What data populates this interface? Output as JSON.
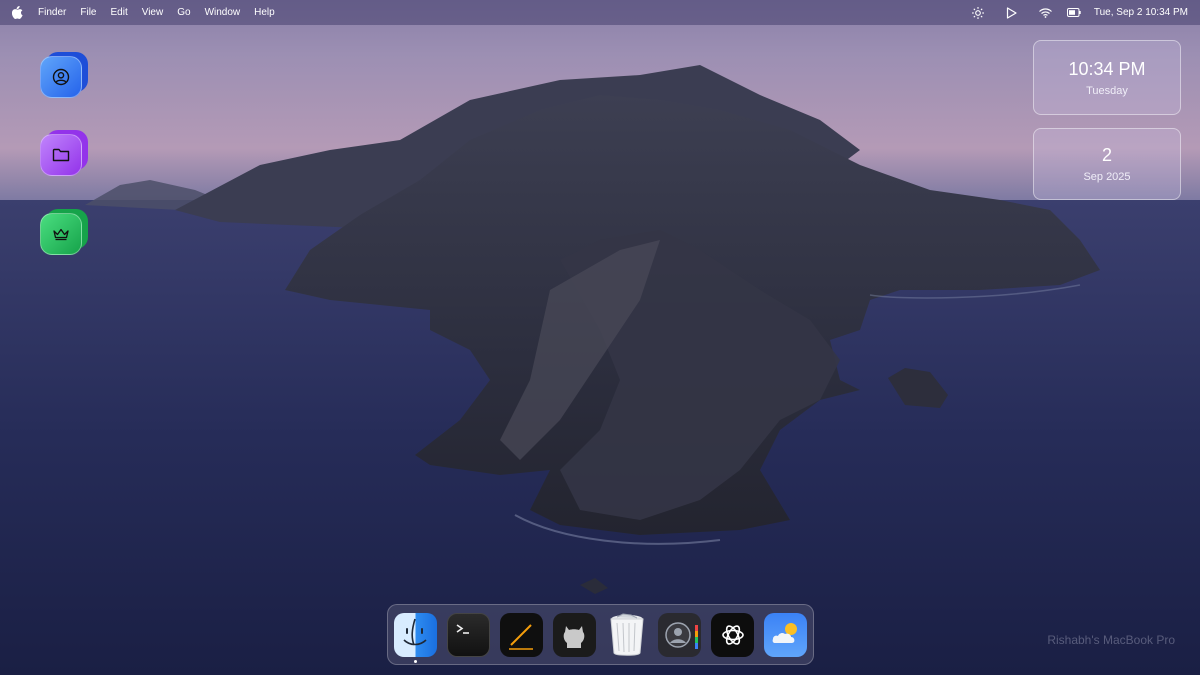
{
  "menubar": {
    "items": [
      "Finder",
      "File",
      "Edit",
      "View",
      "Go",
      "Window",
      "Help"
    ],
    "datetime": "Tue, Sep 2 10:34 PM"
  },
  "widgets": {
    "clock": {
      "time": "10:34 PM",
      "day": "Tuesday"
    },
    "date": {
      "day_number": "2",
      "month_year": "Sep 2025"
    }
  },
  "dock": {
    "apps": [
      "finder-icon",
      "terminal-icon",
      "pen-icon",
      "github-icon",
      "trash-icon",
      "contacts-icon",
      "chatgpt-icon",
      "weather-icon"
    ]
  },
  "watermark": "Rishabh's MacBook Pro",
  "colors": {
    "user_icon": "#3b82f6",
    "folder_icon": "#a855f7",
    "crown_icon": "#22c55e"
  }
}
